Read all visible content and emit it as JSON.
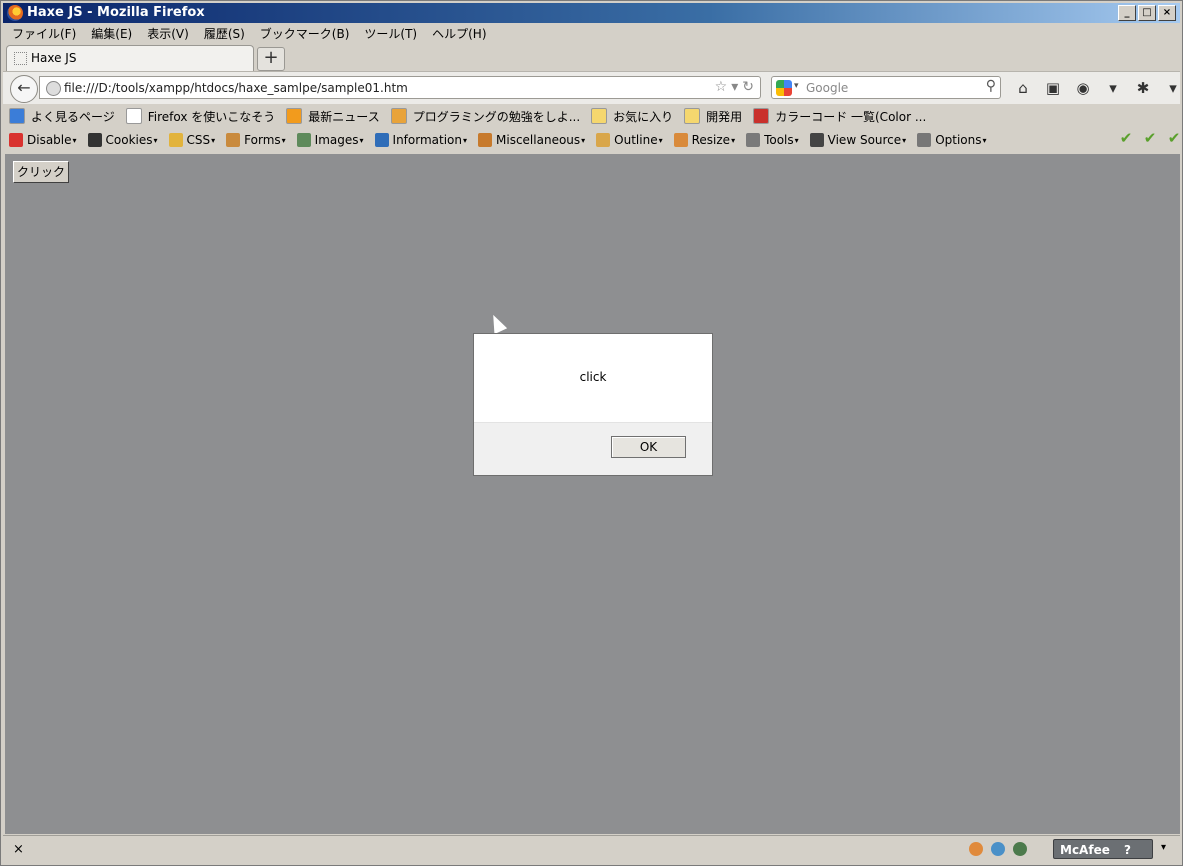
{
  "window": {
    "title": "Haxe JS - Mozilla Firefox",
    "min": "_",
    "max": "□",
    "close": "×"
  },
  "menubar": [
    "ファイル(F)",
    "編集(E)",
    "表示(V)",
    "履歴(S)",
    "ブックマーク(B)",
    "ツール(T)",
    "ヘルプ(H)"
  ],
  "tab": {
    "title": "Haxe JS",
    "new_tab": "+"
  },
  "nav": {
    "back": "←",
    "url": "file:///D:/tools/xampp/htdocs/haxe_samlpe/sample01.htm",
    "star": "☆",
    "dropdown": "▾",
    "reload": "↻",
    "search_placeholder": "Google",
    "search_go": "⚲",
    "home": "⌂",
    "fullscreen": "▣",
    "screenshot": "◉",
    "more": "▾",
    "addon": "✱",
    "menu": "▾"
  },
  "bookmarks": [
    {
      "label": "よく見るページ",
      "color": "#3b7dd8"
    },
    {
      "label": "Firefox を使いこなそう",
      "color": "#ffffff"
    },
    {
      "label": "最新ニュース",
      "color": "#f29b1d"
    },
    {
      "label": "プログラミングの勉強をしよ...",
      "color": "#e8a33a"
    },
    {
      "label": "お気に入り",
      "color": "#f5d76e"
    },
    {
      "label": "開発用",
      "color": "#f5d76e"
    },
    {
      "label": "カラーコード 一覧(Color ...",
      "color": "#c9302c"
    }
  ],
  "webdev": [
    {
      "label": "Disable",
      "color": "#d9322f"
    },
    {
      "label": "Cookies",
      "color": "#333333"
    },
    {
      "label": "CSS",
      "color": "#e2b33c"
    },
    {
      "label": "Forms",
      "color": "#c98a3d"
    },
    {
      "label": "Images",
      "color": "#5e8a5b"
    },
    {
      "label": "Information",
      "color": "#2f6db8"
    },
    {
      "label": "Miscellaneous",
      "color": "#c77a2c"
    },
    {
      "label": "Outline",
      "color": "#d9a64a"
    },
    {
      "label": "Resize",
      "color": "#d98a3a"
    },
    {
      "label": "Tools",
      "color": "#7a7a7a"
    },
    {
      "label": "View Source",
      "color": "#444444"
    },
    {
      "label": "Options",
      "color": "#777777"
    }
  ],
  "checks": [
    "✔",
    "✔",
    "✔"
  ],
  "page": {
    "button_label": "クリック"
  },
  "dialog": {
    "message": "click",
    "ok": "OK"
  },
  "status": {
    "close": "×",
    "mcafee": "McAfee",
    "mcafee_help": "?",
    "caret": "▾"
  }
}
